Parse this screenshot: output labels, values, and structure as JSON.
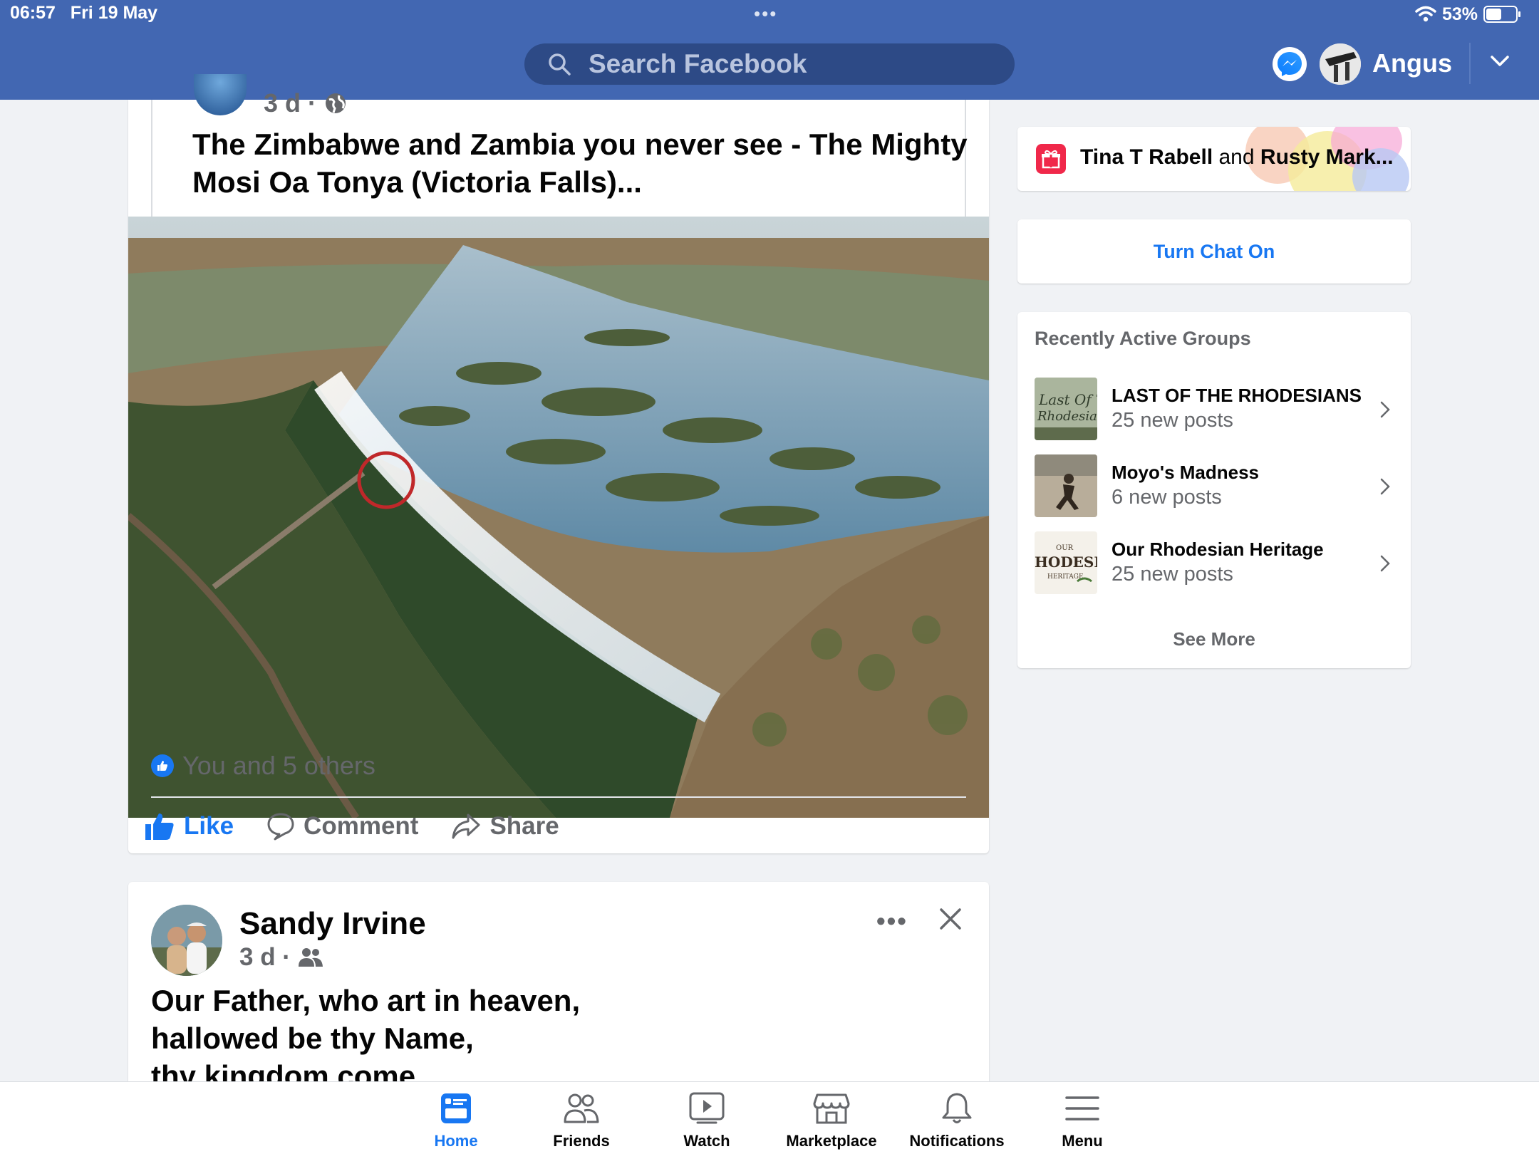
{
  "status_bar": {
    "time": "06:57",
    "date": "Fri 19 May",
    "battery": "53%",
    "battery_level": 0.53
  },
  "search": {
    "placeholder": "Search Facebook"
  },
  "profile": {
    "name": "Angus"
  },
  "post1": {
    "meta_time": "3 d ·",
    "title": "The Zimbabwe and Zambia you never see - The Mighty Mosi Oa Tonya (Victoria Falls)...",
    "reactions": "You and 5 others",
    "actions": {
      "like": "Like",
      "comment": "Comment",
      "share": "Share"
    }
  },
  "post2": {
    "author": "Sandy Irvine",
    "meta_time": "3 d ·",
    "text_lines": [
      "Our Father, who art in heaven,",
      "hallowed be thy Name,",
      "thy kingdom come"
    ]
  },
  "birthday": {
    "name1": "Tina T Rabell",
    "joiner": "and",
    "name2": "Rusty Mark..."
  },
  "chat": {
    "button": "Turn Chat On"
  },
  "groups": {
    "title": "Recently Active Groups",
    "items": [
      {
        "name": "LAST OF THE RHODESIANS",
        "posts": "25 new posts"
      },
      {
        "name": "Moyo's Madness",
        "posts": "6 new posts"
      },
      {
        "name": "Our Rhodesian Heritage",
        "posts": "25 new posts"
      }
    ],
    "see_more": "See More"
  },
  "bottom_nav": {
    "home": "Home",
    "friends": "Friends",
    "watch": "Watch",
    "marketplace": "Marketplace",
    "notifications": "Notifications",
    "menu": "Menu"
  },
  "colors": {
    "header": "#4267b2",
    "accent": "#1877f2",
    "secondary_text": "#65676b"
  }
}
